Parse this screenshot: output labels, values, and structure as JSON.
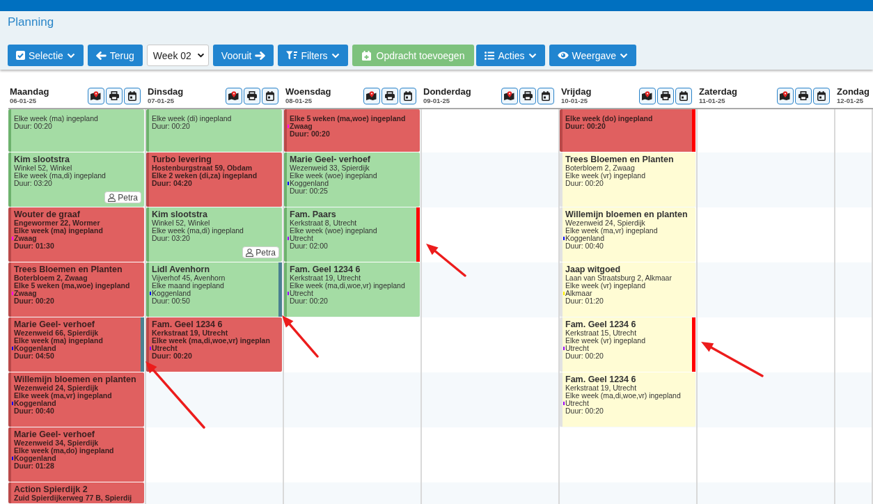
{
  "app": {
    "title": "Planning"
  },
  "toolbar": [
    {
      "kind": "button",
      "label": "Selectie",
      "has_menu": true
    },
    {
      "kind": "button",
      "label": "Terug",
      "has_menu": false
    },
    {
      "kind": "select",
      "value": "Week 02"
    },
    {
      "kind": "button",
      "label": "Vooruit",
      "has_menu": false
    },
    {
      "kind": "button",
      "label": "Filters",
      "has_menu": true
    },
    {
      "kind": "add",
      "label": "Opdracht toevoegen",
      "has_menu": false
    },
    {
      "kind": "button",
      "label": "Acties",
      "has_menu": true
    },
    {
      "kind": "button",
      "label": "Weergave",
      "has_menu": true
    }
  ],
  "days": [
    {
      "name": "Maandag",
      "date": "06-01-25",
      "buttons_visible": true,
      "jobs": [
        {
          "kind": "normal",
          "color": "#a4dca4",
          "schedule": "Elke week (ma) ingepland",
          "duration": "Duur: 00:20"
        },
        {
          "kind": "normal",
          "color": "#a4dca4",
          "title": "Kim slootstra",
          "address": "Winkel 52, Winkel",
          "schedule": "Elke week (ma,di) ingepland",
          "duration": "Duur: 03:20",
          "assignee": "Petra"
        },
        {
          "kind": "alert",
          "color": "#e06060",
          "title": "Wouter de graaf",
          "address": "Engewormer 22, Wormer",
          "schedule": "Elke week (ma) ingepland",
          "region": {
            "name": "Zwaag",
            "color": "#ff00ff"
          },
          "duration": "Duur: 01:30"
        },
        {
          "kind": "alert",
          "color": "#e06060",
          "title": "Trees Bloemen en Planten",
          "address": "Boterbloem 2, Zwaag",
          "schedule": "Elke 5 weken (ma,woe) ingepland",
          "region": {
            "name": "Zwaag",
            "color": "#ff00ff"
          },
          "duration": "Duur: 00:20"
        },
        {
          "kind": "alert",
          "color": "#e06060",
          "title": "Marie Geel- verhoef",
          "address": "Wezenweid 66, Spierdijk",
          "schedule": "Elke week (ma) ingepland",
          "region": {
            "name": "Koggenland",
            "color": "#0000ff"
          },
          "duration": "Duur: 04:50",
          "flag": {
            "color": "#4a8090"
          }
        },
        {
          "kind": "alert",
          "color": "#e06060",
          "title": "Willemijn bloemen en planten",
          "address": "Wezenweid 24, Spierdijk",
          "schedule": "Elke week (ma,vr) ingepland",
          "region": {
            "name": "Koggenland",
            "color": "#0000ff"
          },
          "duration": "Duur: 00:40"
        },
        {
          "kind": "alert",
          "color": "#e06060",
          "title": "Marie Geel- verhoef",
          "address": "Wezenweid 34, Spierdijk",
          "schedule": "Elke week (ma,do) ingepland",
          "region": {
            "name": "Koggenland",
            "color": "#0000ff"
          },
          "duration": "Duur: 01:28"
        },
        {
          "kind": "alert",
          "color": "#e06060",
          "title": "Action Spierdijk 2",
          "address": "Zuid Spierdijkerweg 77 B, Spierdij"
        }
      ]
    },
    {
      "name": "Dinsdag",
      "date": "07-01-25",
      "buttons_visible": true,
      "jobs": [
        {
          "kind": "normal",
          "color": "#a4dca4",
          "schedule": "Elke week (di) ingepland",
          "duration": "Duur: 00:20"
        },
        {
          "kind": "alert",
          "color": "#e06060",
          "title": "Turbo levering",
          "address": "Hostenburgstraat 59, Obdam",
          "schedule": "Elke 2 weken (di,za) ingepland",
          "duration": "Duur: 04:20"
        },
        {
          "kind": "normal",
          "color": "#a4dca4",
          "title": "Kim slootstra",
          "address": "Winkel 52, Winkel",
          "schedule": "Elke week (ma,di) ingepland",
          "duration": "Duur: 03:20",
          "assignee": "Petra"
        },
        {
          "kind": "normal",
          "color": "#a4dca4",
          "title": "Lidl Avenhorn",
          "address": "Vijverhof 45, Avenhorn",
          "schedule": "Elke maand ingepland",
          "region": {
            "name": "Koggenland",
            "color": "#0000ff"
          },
          "duration": "Duur: 00:50",
          "flag": {
            "color": "#4a8090"
          }
        },
        {
          "kind": "alert",
          "color": "#e06060",
          "title": "Fam. Geel 1234 6",
          "address": "Kerkstraat 19, Utrecht",
          "schedule": "Elke week (ma,di,woe,vr) ingeplan",
          "region": {
            "name": "Utrecht",
            "color": "#9900ff"
          },
          "duration": "Duur: 00:20"
        }
      ]
    },
    {
      "name": "Woensdag",
      "date": "08-01-25",
      "buttons_visible": true,
      "jobs": [
        {
          "kind": "alert",
          "color": "#e06060",
          "schedule": "Elke 5 weken (ma,woe) ingepland",
          "region": {
            "name": "Zwaag",
            "color": "#ff00ff"
          },
          "duration": "Duur: 00:20"
        },
        {
          "kind": "normal",
          "color": "#a4dca4",
          "title": "Marie Geel- verhoef",
          "address": "Wezenweid 33, Spierdijk",
          "schedule": "Elke week (woe) ingepland",
          "region": {
            "name": "Koggenland",
            "color": "#0000ff"
          },
          "duration": "Duur: 00:25"
        },
        {
          "kind": "normal",
          "color": "#a4dca4",
          "title": "Fam. Paars",
          "address": "Kerkstraat 8, Utrecht",
          "schedule": "Elke week (woe) ingepland",
          "region": {
            "name": "Utrecht",
            "color": "#9900ff"
          },
          "duration": "Duur: 02:00",
          "flag": {
            "color": "#ff0000"
          }
        },
        {
          "kind": "normal",
          "color": "#a4dca4",
          "title": "Fam. Geel 1234 6",
          "address": "Kerkstraat 19, Utrecht",
          "schedule": "Elke week (ma,di,woe,vr) ingepland",
          "region": {
            "name": "Utrecht",
            "color": "#9900ff"
          },
          "duration": "Duur: 00:20"
        }
      ]
    },
    {
      "name": "Donderdag",
      "date": "09-01-25",
      "buttons_visible": true
    },
    {
      "name": "Vrijdag",
      "date": "10-01-25",
      "buttons_visible": true,
      "jobs": [
        {
          "kind": "alert",
          "color": "#e06060",
          "schedule": "Elke week (do) ingepland",
          "duration": "Duur: 00:20",
          "flag": {
            "color": "#ff0000"
          }
        },
        {
          "kind": "pale",
          "color": "#fffcd4",
          "title": "Trees Bloemen en Planten",
          "address": "Boterbloem 2, Zwaag",
          "schedule": "Elke week (vr) ingepland",
          "duration": "Duur: 00:20"
        },
        {
          "kind": "pale",
          "color": "#fffcd4",
          "title": "Willemijn bloemen en planten",
          "address": "Wezenweid 24, Spierdijk",
          "schedule": "Elke week (ma,vr) ingepland",
          "region": {
            "name": "Koggenland",
            "color": "#0000ff"
          },
          "duration": "Duur: 00:40"
        },
        {
          "kind": "pale",
          "color": "#fffcd4",
          "title": "Jaap witgoed",
          "address": "Laan van Straatsburg 2, Alkmaar",
          "schedule": "Elke week (vr) ingepland",
          "region": {
            "name": "Alkmaar",
            "color": "#ffee00"
          },
          "duration": "Duur: 01:20"
        },
        {
          "kind": "pale",
          "color": "#fffcd4",
          "title": "Fam. Geel 1234 6",
          "address": "Kerkstraat 15, Utrecht",
          "schedule": "Elke week (vr) ingepland",
          "region": {
            "name": "Utrecht",
            "color": "#9900ff"
          },
          "duration": "Duur: 00:20",
          "flag": {
            "color": "#ff0000"
          }
        },
        {
          "kind": "pale",
          "color": "#fffcd4",
          "title": "Fam. Geel 1234 6",
          "address": "Kerkstraat 19, Utrecht",
          "schedule": "Elke week (ma,di,woe,vr) ingepland",
          "region": {
            "name": "Utrecht",
            "color": "#9900ff"
          },
          "duration": "Duur: 00:20"
        }
      ]
    },
    {
      "name": "Zaterdag",
      "date": "11-01-25",
      "buttons_visible": true
    },
    {
      "name": "Zondag",
      "date": "12-01-25",
      "buttons_visible": false
    }
  ],
  "annotations": [
    {
      "kind": "arrow"
    },
    {
      "kind": "arrow"
    },
    {
      "kind": "arrow"
    },
    {
      "kind": "arrow"
    }
  ]
}
